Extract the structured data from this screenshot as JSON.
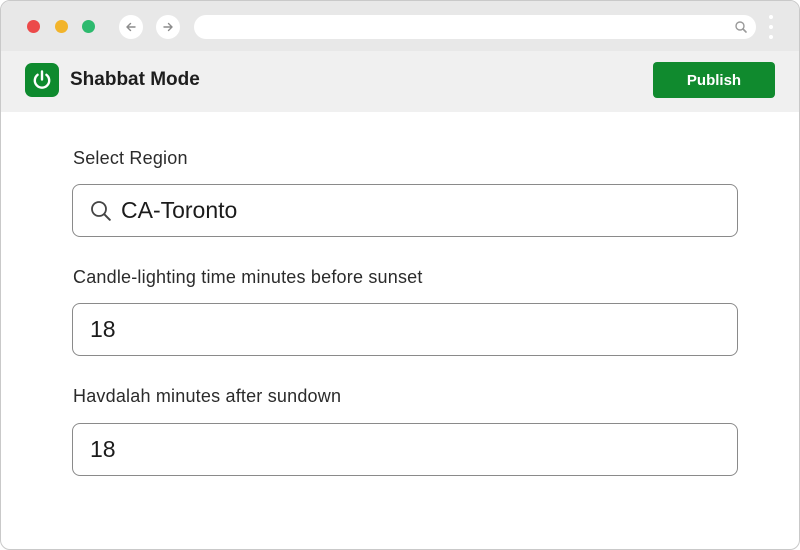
{
  "browser": {
    "window_controls": [
      "close",
      "minimize",
      "maximize"
    ],
    "icons": {
      "back": "arrow-left-icon",
      "forward": "arrow-right-icon",
      "url_search": "search-icon",
      "menu": "kebab-menu-icon"
    },
    "url_value": ""
  },
  "header": {
    "logo_icon": "power-icon",
    "title": "Shabbat Mode",
    "publish_label": "Publish"
  },
  "form": {
    "region": {
      "label": "Select Region",
      "value": "CA-Toronto",
      "icon": "search-icon"
    },
    "candle_lighting": {
      "label": "Candle-lighting time minutes before sunset",
      "value": "18"
    },
    "havdalah": {
      "label": "Havdalah minutes after sundown",
      "value": "18"
    }
  },
  "colors": {
    "brand_green": "#108a2e",
    "close_dot": "#ec4a4a",
    "minimize_dot": "#f2b42b",
    "maximize_dot": "#2dba6e"
  }
}
